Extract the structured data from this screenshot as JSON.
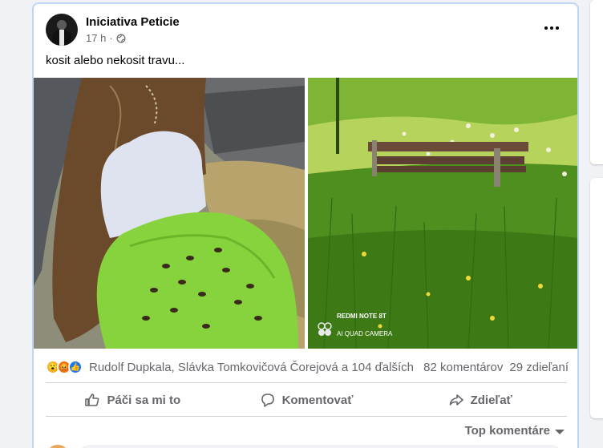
{
  "post": {
    "author": "Iniciativa Peticie",
    "time": "17 h",
    "separator": "·",
    "text": "kosit alebo nekosit travu..."
  },
  "photos": {
    "right_watermark_line1": "REDMI NOTE 8T",
    "right_watermark_line2": "AI QUAD CAMERA"
  },
  "reactions": {
    "names": "Rudolf Dupkala, Slávka Tomkovičová Čorejová a 104 ďalších",
    "comments": "82 komentárov",
    "shares": "29 zdieľaní"
  },
  "actions": {
    "like": "Páči sa mi to",
    "comment": "Komentovať",
    "share": "Zdieľať"
  },
  "comments": {
    "sort_label": "Top komentáre"
  },
  "icons": {
    "globe": "globe-icon",
    "more": "more-options-icon",
    "like": "thumbs-up-icon",
    "comment": "comment-bubble-icon",
    "share": "share-arrow-icon"
  },
  "colors": {
    "accent": "#1877f2",
    "secondary_text": "#65676b",
    "post_border": "#bcd6f3"
  }
}
